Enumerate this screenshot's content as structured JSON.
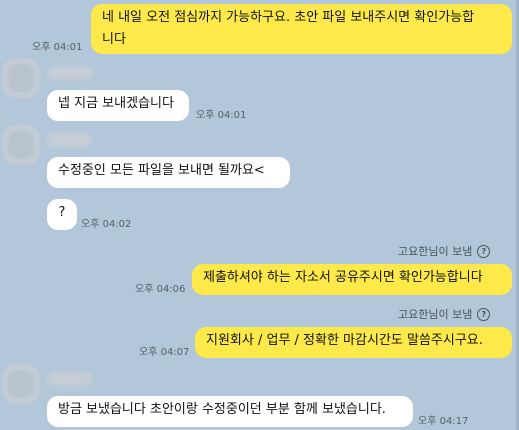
{
  "messages": [
    {
      "id": "m1",
      "sender": "me",
      "text_line1": "네 내일 오전 점심까지 가능하구요. 초안 파일 보내주시면 확인가능합",
      "text_line2": "니다",
      "time": "오후 04:01"
    },
    {
      "id": "m2",
      "sender": "them",
      "text": "넵 지금 보내겠습니다",
      "time": "오후 04:01"
    },
    {
      "id": "m3",
      "sender": "them",
      "text": "수정중인 모든 파일을 보내면 될까요<",
      "time": ""
    },
    {
      "id": "m4",
      "sender": "them",
      "text": "?",
      "time": "오후 04:02"
    },
    {
      "id": "m5",
      "sender": "me",
      "read_status": "고요한님이 보냄",
      "text": "제출하셔야 하는 자소서 공유주시면 확인가능합니다",
      "time": "오후 04:06"
    },
    {
      "id": "m6",
      "sender": "me",
      "read_status": "고요한님이 보냄",
      "text": "지원회사 / 업무 / 정확한 마감시간도 말씀주시구요.",
      "time": "오후 04:07"
    },
    {
      "id": "m7",
      "sender": "them",
      "text": "방금 보냈습니다 초안이랑 수정중이던 부분 함께 보냈습니다.",
      "time": "오후 04:17"
    }
  ],
  "icons": {
    "help": "question-circle-icon"
  },
  "colors": {
    "background": "#b2c7d9",
    "my_bubble": "#fde94a",
    "their_bubble": "#ffffff"
  }
}
